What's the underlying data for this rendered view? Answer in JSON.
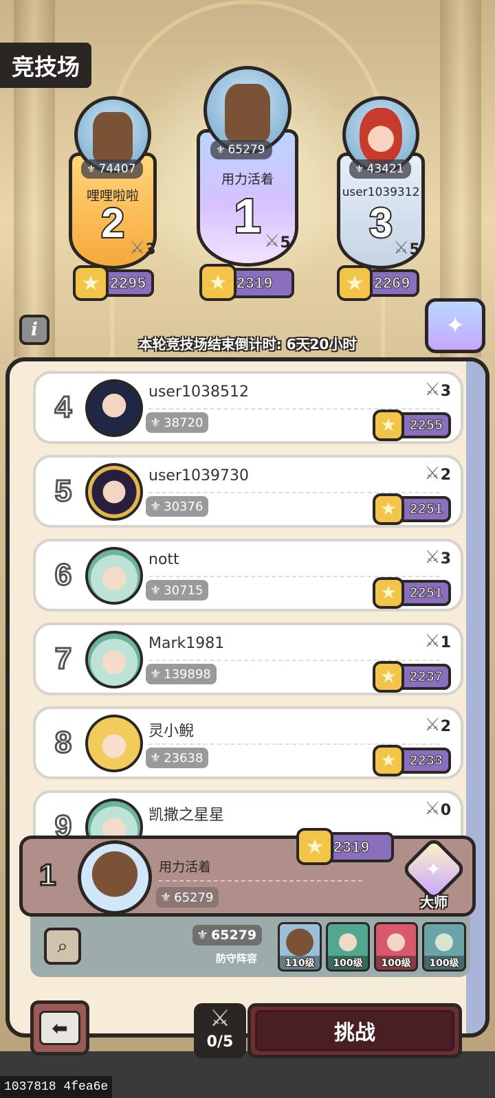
{
  "title": "竞技场",
  "countdown": "本轮竞技场结束倒计时: 6天20小时",
  "podium": [
    {
      "rank": "2",
      "name": "哩哩啦啦",
      "power": "74407",
      "swords": "3",
      "score": "2295",
      "banner": "gold",
      "avatar": "bronze-mask-hero"
    },
    {
      "rank": "1",
      "name": "用力活着",
      "power": "65279",
      "swords": "5",
      "score": "2319",
      "banner": "purple",
      "avatar": "bronze-mask-hero"
    },
    {
      "rank": "3",
      "name": "user1039312",
      "power": "43421",
      "swords": "5",
      "score": "2269",
      "banner": "silver",
      "avatar": "red-hair-hero"
    }
  ],
  "leaderboard": [
    {
      "rank": "4",
      "name": "user1038512",
      "power": "38720",
      "swords": "3",
      "score": "2255",
      "avatar": "dark-hair-hero"
    },
    {
      "rank": "5",
      "name": "user1039730",
      "power": "30376",
      "swords": "2",
      "score": "2251",
      "avatar": "yellow-armor-hero"
    },
    {
      "rank": "6",
      "name": "nott",
      "power": "30715",
      "swords": "3",
      "score": "2251",
      "avatar": "green-elf-hero"
    },
    {
      "rank": "7",
      "name": "Mark1981",
      "power": "139898",
      "swords": "1",
      "score": "2237",
      "avatar": "green-elf-hero"
    },
    {
      "rank": "8",
      "name": "灵小鲵",
      "power": "23638",
      "swords": "2",
      "score": "2233",
      "avatar": "blonde-hero"
    },
    {
      "rank": "9",
      "name": "凯撒之星星",
      "power": "",
      "swords": "0",
      "score": "",
      "avatar": "green-elf-hero"
    }
  ],
  "my_rank": {
    "rank": "1",
    "name": "用力活着",
    "power": "65279",
    "score": "2319",
    "tier": "大师"
  },
  "defense": {
    "power": "65279",
    "label": "防守阵容",
    "heroes": [
      {
        "level": "110级"
      },
      {
        "level": "100级"
      },
      {
        "level": "100级"
      },
      {
        "level": "100级"
      }
    ]
  },
  "attempts": "0/5",
  "challenge_label": "挑战",
  "footer_id": "1037818 4fea6e",
  "icons": {
    "power": "power-emblem-icon",
    "sword": "crossed-swords-icon",
    "star": "star-icon",
    "info": "info-icon",
    "chest": "reward-chest-icon",
    "zoom": "magnifier-icon",
    "back": "back-arrow-icon"
  },
  "colors": {
    "score_pill": "#8a6fbf",
    "star": "#f3c44a",
    "challenge": "#6c2e33"
  }
}
